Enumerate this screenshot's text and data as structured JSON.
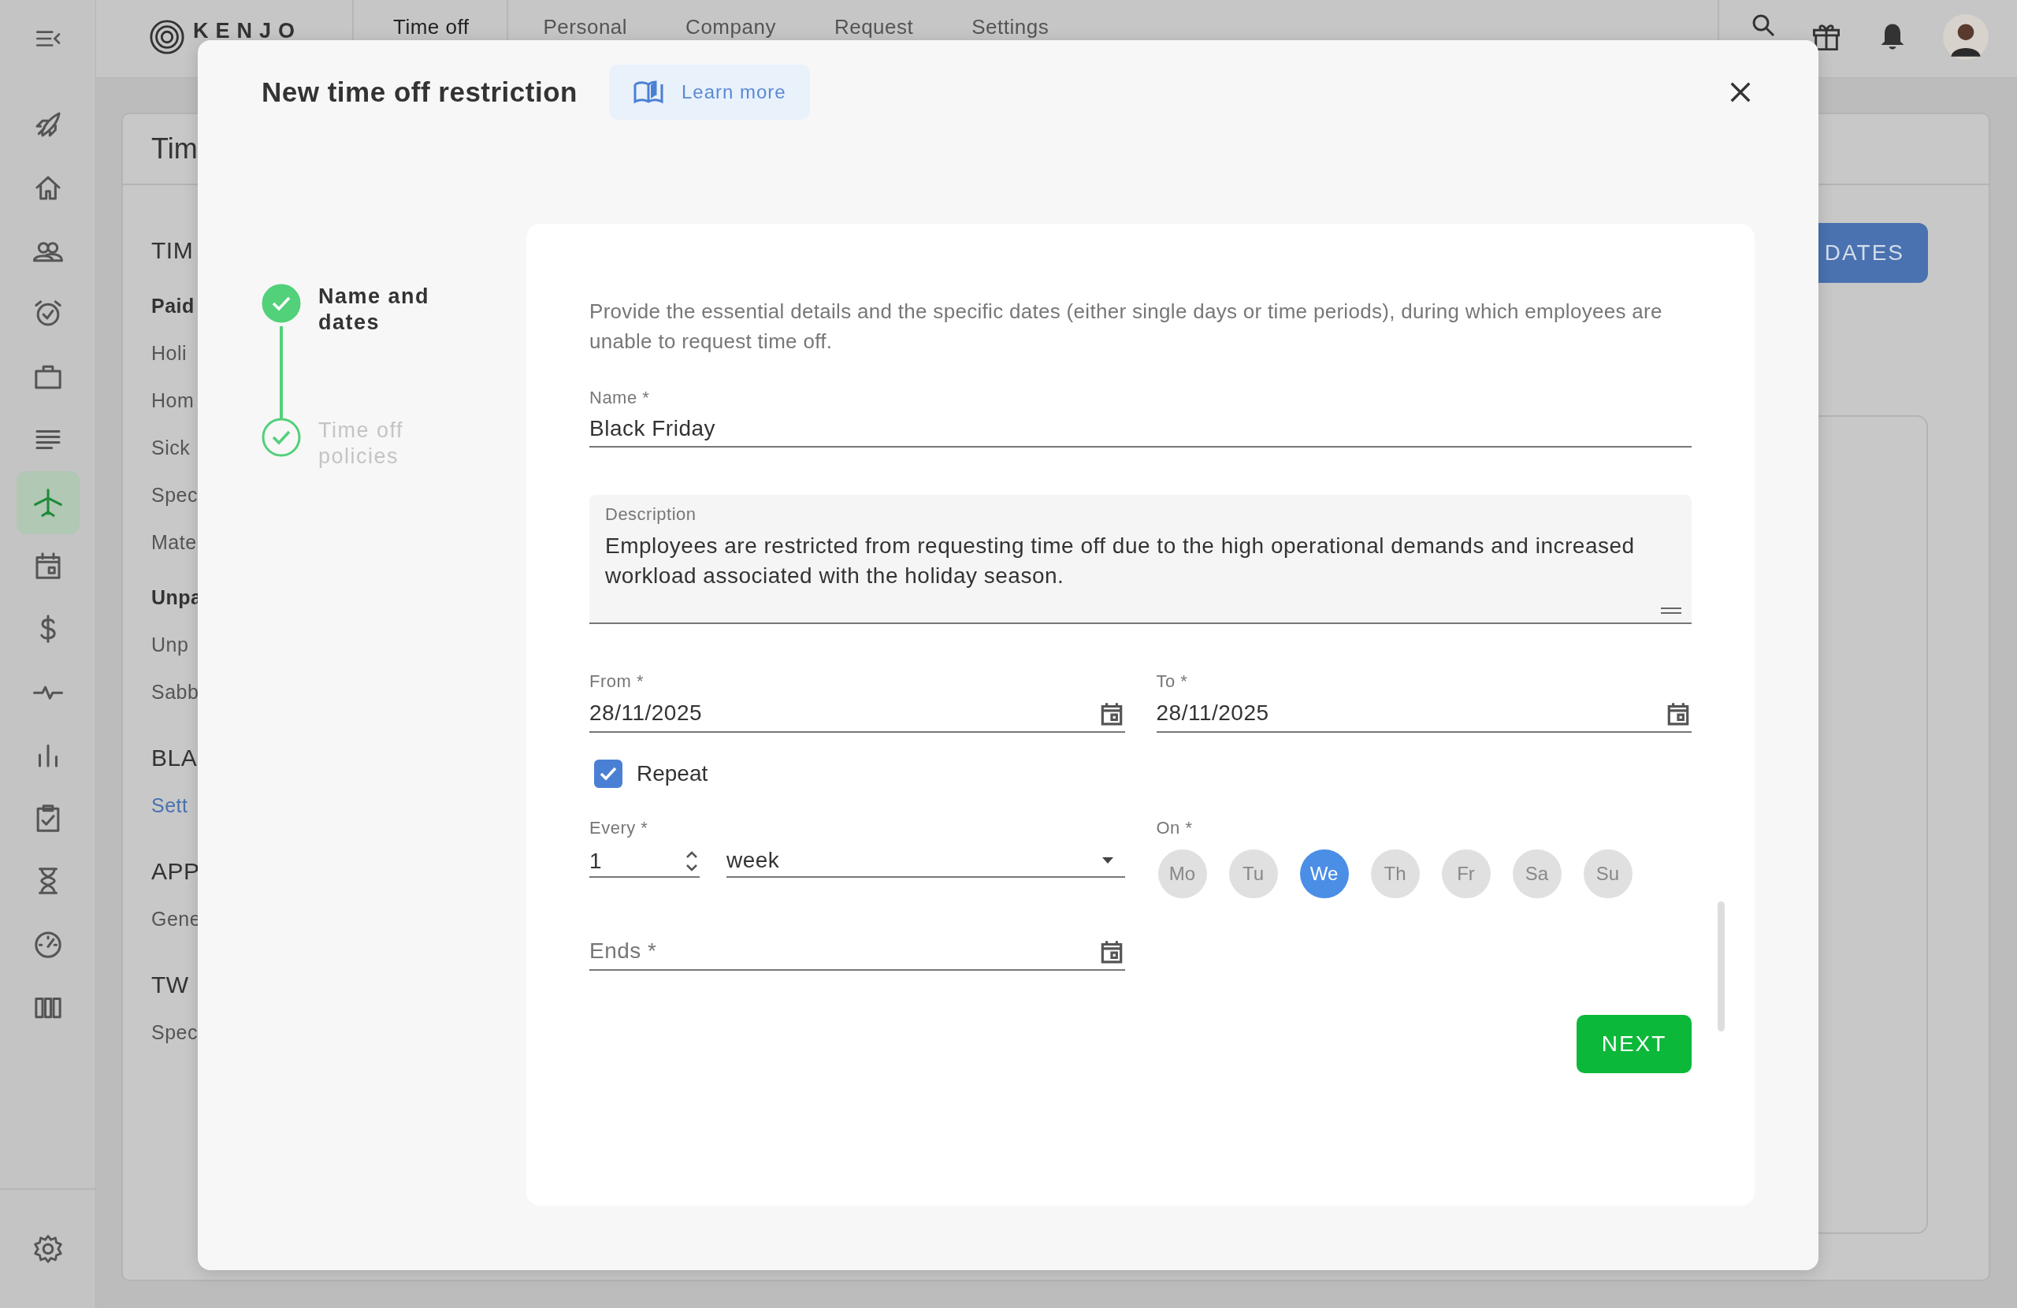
{
  "topbar": {
    "logo": "KENJO",
    "nav": [
      {
        "label": "Time off",
        "selected": true
      },
      {
        "label": "Personal",
        "selected": false
      },
      {
        "label": "Company",
        "selected": false
      },
      {
        "label": "Request",
        "selected": false
      },
      {
        "label": "Settings",
        "selected": false
      }
    ]
  },
  "sidebar": {
    "items": [
      {
        "selected": false
      },
      {
        "selected": false
      },
      {
        "selected": false
      },
      {
        "selected": false
      },
      {
        "selected": false
      },
      {
        "selected": false
      },
      {
        "selected": true
      },
      {
        "selected": false
      },
      {
        "selected": false
      },
      {
        "selected": false
      },
      {
        "selected": false
      },
      {
        "selected": false
      },
      {
        "selected": false
      },
      {
        "selected": false
      },
      {
        "selected": false
      }
    ],
    "footer_item": {
      "selected": false
    }
  },
  "background": {
    "title": "Tim",
    "lines": [
      {
        "kind": "section",
        "text": "TIM"
      },
      {
        "kind": "group",
        "text": "Paid"
      },
      {
        "kind": "item",
        "text": "Holi"
      },
      {
        "kind": "item",
        "text": "Hom"
      },
      {
        "kind": "item",
        "text": "Sick"
      },
      {
        "kind": "item",
        "text": "Spec"
      },
      {
        "kind": "item",
        "text": "Mate"
      },
      {
        "kind": "group",
        "text": "Unpa"
      },
      {
        "kind": "item",
        "text": "Unp"
      },
      {
        "kind": "item",
        "text": "Sabb"
      },
      {
        "kind": "section",
        "text": "BLA"
      },
      {
        "kind": "link",
        "text": "Sett"
      },
      {
        "kind": "section",
        "text": "APP"
      },
      {
        "kind": "item",
        "text": "Gene"
      },
      {
        "kind": "section",
        "text": "TW"
      },
      {
        "kind": "item",
        "text": "Spec"
      }
    ],
    "button": "DATES"
  },
  "modal": {
    "title": "New time off restriction",
    "learn_more": "Learn more",
    "steps": [
      {
        "label": "Name and dates",
        "selected": true
      },
      {
        "label": "Time off policies",
        "selected": false
      }
    ],
    "intro": "Provide the essential details and the specific dates (either single days or time periods), during which employees are unable to request time off.",
    "name": {
      "label": "Name *",
      "value": "Black Friday"
    },
    "description": {
      "label": "Description",
      "value": "Employees are restricted from requesting time off due to the high operational demands and increased workload associated with the holiday season."
    },
    "from": {
      "label": "From *",
      "value": "28/11/2025"
    },
    "to": {
      "label": "To *",
      "value": "28/11/2025"
    },
    "repeat": {
      "label": "Repeat",
      "checked": true
    },
    "every": {
      "label": "Every *",
      "value": "1",
      "unit": "week"
    },
    "on": {
      "label": "On *",
      "days": [
        {
          "label": "Mo",
          "selected": false
        },
        {
          "label": "Tu",
          "selected": false
        },
        {
          "label": "We",
          "selected": true
        },
        {
          "label": "Th",
          "selected": false
        },
        {
          "label": "Fr",
          "selected": false
        },
        {
          "label": "Sa",
          "selected": false
        },
        {
          "label": "Su",
          "selected": false
        }
      ]
    },
    "ends": {
      "placeholder": "Ends *"
    },
    "next": "NEXT"
  }
}
